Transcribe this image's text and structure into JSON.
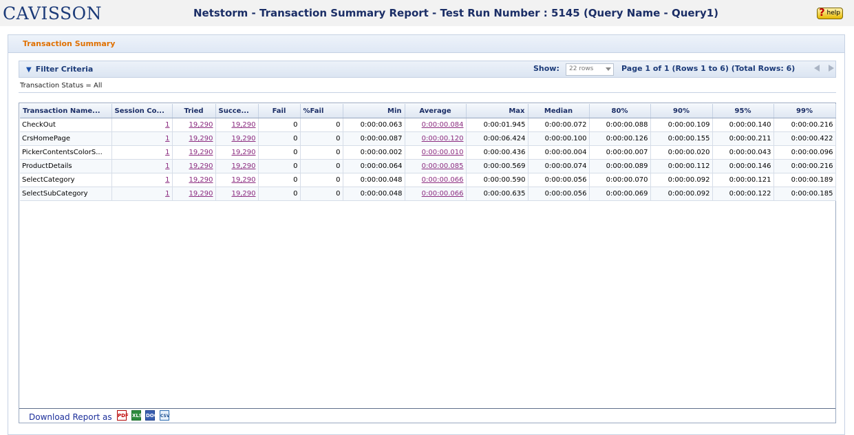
{
  "header": {
    "logo_text": "CAVISSON",
    "title": "Netstorm - Transaction Summary Report - Test Run Number : 5145 (Query Name - Query1)",
    "help_label": "help"
  },
  "panel": {
    "title": "Transaction Summary"
  },
  "filter": {
    "toggle_label": "Filter Criteria",
    "show_label": "Show:",
    "rows_value": "22 rows",
    "page_info": "Page 1 of 1 (Rows 1 to 6) (Total Rows: 6)",
    "status_text": "Transaction Status = All"
  },
  "table": {
    "columns": [
      "Transaction Name...",
      "Session Co...",
      "Tried",
      "Succe...",
      "Fail",
      "%Fail",
      "Min",
      "Average",
      "Max",
      "Median",
      "80%",
      "90%",
      "95%",
      "99%"
    ],
    "rows": [
      [
        "CheckOut",
        "1",
        "19,290",
        "19,290",
        "0",
        "0",
        "0:00:00.063",
        "0:00:00.084",
        "0:00:01.945",
        "0:00:00.072",
        "0:00:00.088",
        "0:00:00.109",
        "0:00:00.140",
        "0:00:00.216"
      ],
      [
        "CrsHomePage",
        "1",
        "19,290",
        "19,290",
        "0",
        "0",
        "0:00:00.087",
        "0:00:00.120",
        "0:00:06.424",
        "0:00:00.100",
        "0:00:00.126",
        "0:00:00.155",
        "0:00:00.211",
        "0:00:00.422"
      ],
      [
        "PickerContentsColorS...",
        "1",
        "19,290",
        "19,290",
        "0",
        "0",
        "0:00:00.002",
        "0:00:00.010",
        "0:00:00.436",
        "0:00:00.004",
        "0:00:00.007",
        "0:00:00.020",
        "0:00:00.043",
        "0:00:00.096"
      ],
      [
        "ProductDetails",
        "1",
        "19,290",
        "19,290",
        "0",
        "0",
        "0:00:00.064",
        "0:00:00.085",
        "0:00:00.569",
        "0:00:00.074",
        "0:00:00.089",
        "0:00:00.112",
        "0:00:00.146",
        "0:00:00.216"
      ],
      [
        "SelectCategory",
        "1",
        "19,290",
        "19,290",
        "0",
        "0",
        "0:00:00.048",
        "0:00:00.066",
        "0:00:00.590",
        "0:00:00.056",
        "0:00:00.070",
        "0:00:00.092",
        "0:00:00.121",
        "0:00:00.189"
      ],
      [
        "SelectSubCategory",
        "1",
        "19,290",
        "19,290",
        "0",
        "0",
        "0:00:00.048",
        "0:00:00.066",
        "0:00:00.635",
        "0:00:00.056",
        "0:00:00.069",
        "0:00:00.092",
        "0:00:00.122",
        "0:00:00.185"
      ]
    ]
  },
  "footer": {
    "download_label": "Download Report  as",
    "formats": [
      "PDF",
      "XLS",
      "DOC",
      "CSV"
    ]
  },
  "colors": {
    "title": "#1b2e66",
    "panel_title": "#e07000",
    "link": "#8a2a7f"
  }
}
